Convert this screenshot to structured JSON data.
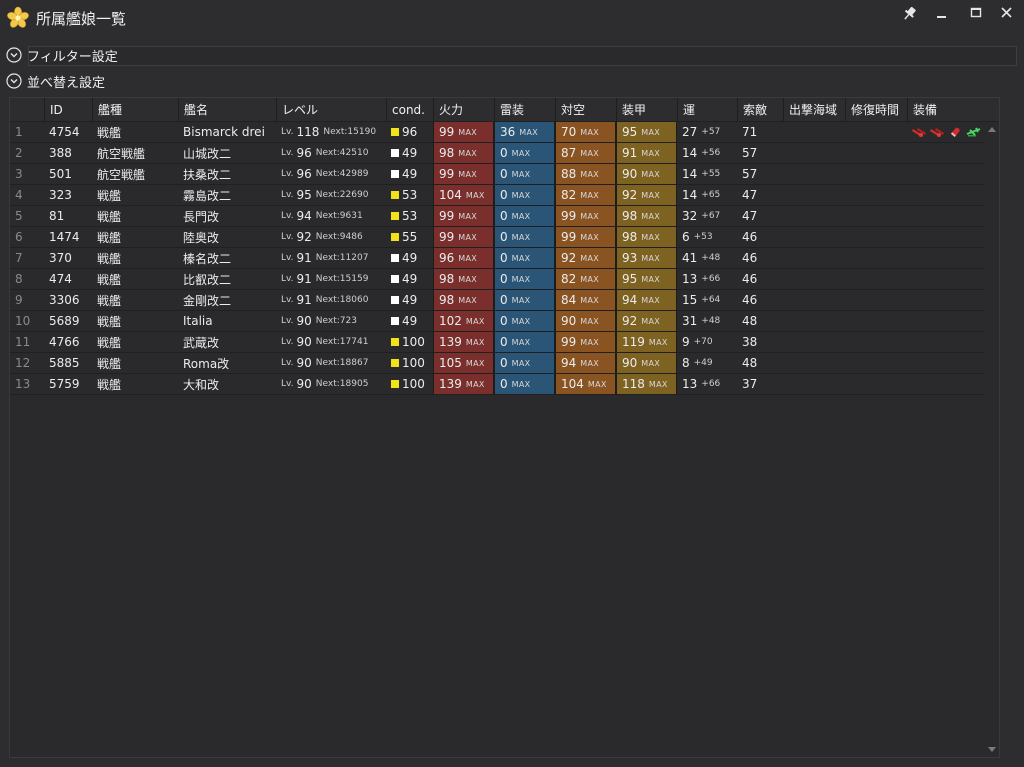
{
  "window": {
    "title": "所属艦娘一覧",
    "icons": [
      "star-flower-icon",
      "pin-icon",
      "minimize-icon",
      "maximize-icon",
      "close-icon"
    ]
  },
  "sections": {
    "filter_label": "フィルター設定",
    "sort_label": "並べ替え設定"
  },
  "columns": [
    "",
    "ID",
    "艦種",
    "艦名",
    "レベル",
    "cond.",
    "火力",
    "雷装",
    "対空",
    "装甲",
    "運",
    "索敵",
    "出撃海域",
    "修復時間",
    "装備"
  ],
  "labels": {
    "lv_prefix": "Lv.",
    "next_prefix": "Next:",
    "max": "MAX"
  },
  "colors": {
    "firepower": "#7a2f2c",
    "torpedo": "#2b5576",
    "antiair": "#8a5422",
    "armor": "#7e6222",
    "cond_yellow": "#f2e21a",
    "cond_white": "#ffffff"
  },
  "rows": [
    {
      "n": "1",
      "id": "4754",
      "type": "戦艦",
      "name": "Bismarck drei",
      "lv": "118",
      "next": "15190",
      "cond": "96",
      "cond_color": "yellow",
      "fp": "99",
      "fp_max": true,
      "tp": "36",
      "tp_max": true,
      "aa": "70",
      "aa_max": true,
      "ar": "95",
      "ar_max": true,
      "luck": "27",
      "luck_plus": "+57",
      "los": "71",
      "equip": [
        "main-gun-icon",
        "main-gun-icon",
        "shell-icon",
        "seaplane-icon"
      ]
    },
    {
      "n": "2",
      "id": "388",
      "type": "航空戦艦",
      "name": "山城改二",
      "lv": "96",
      "next": "42510",
      "cond": "49",
      "cond_color": "white",
      "fp": "98",
      "fp_max": true,
      "tp": "0",
      "tp_max": true,
      "aa": "87",
      "aa_max": true,
      "ar": "91",
      "ar_max": true,
      "luck": "14",
      "luck_plus": "+56",
      "los": "57",
      "equip": []
    },
    {
      "n": "3",
      "id": "501",
      "type": "航空戦艦",
      "name": "扶桑改二",
      "lv": "96",
      "next": "42989",
      "cond": "49",
      "cond_color": "white",
      "fp": "99",
      "fp_max": true,
      "tp": "0",
      "tp_max": true,
      "aa": "88",
      "aa_max": true,
      "ar": "90",
      "ar_max": true,
      "luck": "14",
      "luck_plus": "+55",
      "los": "57",
      "equip": []
    },
    {
      "n": "4",
      "id": "323",
      "type": "戦艦",
      "name": "霧島改二",
      "lv": "95",
      "next": "22690",
      "cond": "53",
      "cond_color": "yellow",
      "fp": "104",
      "fp_max": true,
      "tp": "0",
      "tp_max": true,
      "aa": "82",
      "aa_max": true,
      "ar": "92",
      "ar_max": true,
      "luck": "14",
      "luck_plus": "+65",
      "los": "47",
      "equip": []
    },
    {
      "n": "5",
      "id": "81",
      "type": "戦艦",
      "name": "長門改",
      "lv": "94",
      "next": "9631",
      "cond": "53",
      "cond_color": "yellow",
      "fp": "99",
      "fp_max": true,
      "tp": "0",
      "tp_max": true,
      "aa": "99",
      "aa_max": true,
      "ar": "98",
      "ar_max": true,
      "luck": "32",
      "luck_plus": "+67",
      "los": "47",
      "equip": []
    },
    {
      "n": "6",
      "id": "1474",
      "type": "戦艦",
      "name": "陸奥改",
      "lv": "92",
      "next": "9486",
      "cond": "55",
      "cond_color": "yellow",
      "fp": "99",
      "fp_max": true,
      "tp": "0",
      "tp_max": true,
      "aa": "99",
      "aa_max": true,
      "ar": "98",
      "ar_max": true,
      "luck": "6",
      "luck_plus": "+53",
      "los": "46",
      "equip": []
    },
    {
      "n": "7",
      "id": "370",
      "type": "戦艦",
      "name": "榛名改二",
      "lv": "91",
      "next": "11207",
      "cond": "49",
      "cond_color": "white",
      "fp": "96",
      "fp_max": true,
      "tp": "0",
      "tp_max": true,
      "aa": "92",
      "aa_max": true,
      "ar": "93",
      "ar_max": true,
      "luck": "41",
      "luck_plus": "+48",
      "los": "46",
      "equip": []
    },
    {
      "n": "8",
      "id": "474",
      "type": "戦艦",
      "name": "比叡改二",
      "lv": "91",
      "next": "15159",
      "cond": "49",
      "cond_color": "white",
      "fp": "98",
      "fp_max": true,
      "tp": "0",
      "tp_max": true,
      "aa": "82",
      "aa_max": true,
      "ar": "95",
      "ar_max": true,
      "luck": "13",
      "luck_plus": "+66",
      "los": "46",
      "equip": []
    },
    {
      "n": "9",
      "id": "3306",
      "type": "戦艦",
      "name": "金剛改二",
      "lv": "91",
      "next": "18060",
      "cond": "49",
      "cond_color": "white",
      "fp": "98",
      "fp_max": true,
      "tp": "0",
      "tp_max": true,
      "aa": "84",
      "aa_max": true,
      "ar": "94",
      "ar_max": true,
      "luck": "15",
      "luck_plus": "+64",
      "los": "46",
      "equip": []
    },
    {
      "n": "10",
      "id": "5689",
      "type": "戦艦",
      "name": "Italia",
      "lv": "90",
      "next": "723",
      "cond": "49",
      "cond_color": "white",
      "fp": "102",
      "fp_max": true,
      "tp": "0",
      "tp_max": true,
      "aa": "90",
      "aa_max": true,
      "ar": "92",
      "ar_max": true,
      "luck": "31",
      "luck_plus": "+48",
      "los": "48",
      "equip": []
    },
    {
      "n": "11",
      "id": "4766",
      "type": "戦艦",
      "name": "武蔵改",
      "lv": "90",
      "next": "17741",
      "cond": "100",
      "cond_color": "yellow",
      "fp": "139",
      "fp_max": true,
      "tp": "0",
      "tp_max": true,
      "aa": "99",
      "aa_max": true,
      "ar": "119",
      "ar_max": true,
      "luck": "9",
      "luck_plus": "+70",
      "los": "38",
      "equip": []
    },
    {
      "n": "12",
      "id": "5885",
      "type": "戦艦",
      "name": "Roma改",
      "lv": "90",
      "next": "18867",
      "cond": "100",
      "cond_color": "yellow",
      "fp": "105",
      "fp_max": true,
      "tp": "0",
      "tp_max": true,
      "aa": "94",
      "aa_max": true,
      "ar": "90",
      "ar_max": true,
      "luck": "8",
      "luck_plus": "+49",
      "los": "48",
      "equip": []
    },
    {
      "n": "13",
      "id": "5759",
      "type": "戦艦",
      "name": "大和改",
      "lv": "90",
      "next": "18905",
      "cond": "100",
      "cond_color": "yellow",
      "fp": "139",
      "fp_max": true,
      "tp": "0",
      "tp_max": true,
      "aa": "104",
      "aa_max": true,
      "ar": "118",
      "ar_max": true,
      "luck": "13",
      "luck_plus": "+66",
      "los": "37",
      "equip": []
    }
  ]
}
